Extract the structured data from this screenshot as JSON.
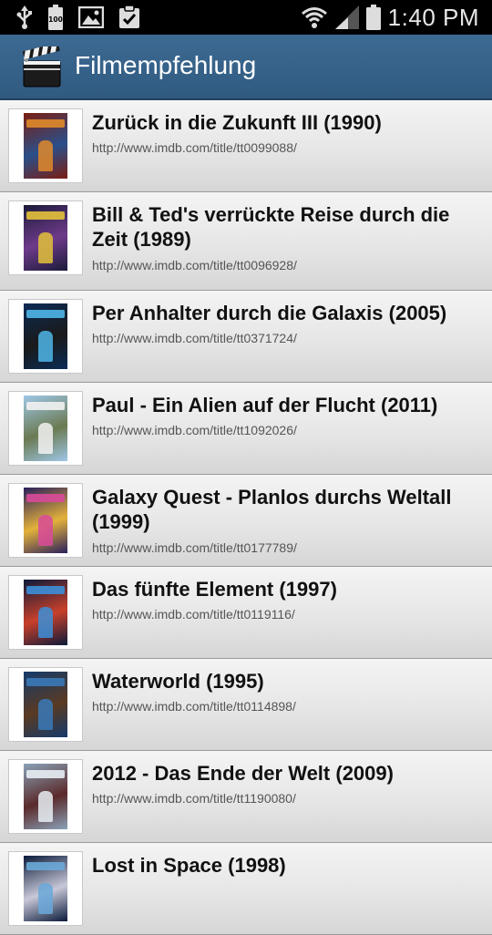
{
  "status_bar": {
    "time": "1:40 PM",
    "battery_level_text": "100",
    "left_icons": [
      "usb-icon",
      "battery-full-icon",
      "image-icon",
      "clipboard-check-icon"
    ],
    "right_icons": [
      "wifi-icon",
      "cell-signal-icon",
      "battery-icon"
    ]
  },
  "app_bar": {
    "title": "Filmempfehlung",
    "icon": "clapperboard-icon",
    "background": "#35618a"
  },
  "movies": [
    {
      "title": "Zurück in die Zukunft III (1990)",
      "url": "http://www.imdb.com/title/tt0099088/",
      "poster_colors": [
        "#7a1e12",
        "#e08a2a",
        "#2a4f8a"
      ]
    },
    {
      "title": "Bill & Ted's verrückte Reise durch die Zeit (1989)",
      "url": "http://www.imdb.com/title/tt0096928/",
      "poster_colors": [
        "#1c1b3a",
        "#e3c23a",
        "#6e3a8a"
      ]
    },
    {
      "title": "Per Anhalter durch die Galaxis (2005)",
      "url": "http://www.imdb.com/title/tt0371724/",
      "poster_colors": [
        "#0b2b55",
        "#4fb6e8",
        "#1a1a1a"
      ]
    },
    {
      "title": "Paul - Ein Alien auf der Flucht (2011)",
      "url": "http://www.imdb.com/title/tt1092026/",
      "poster_colors": [
        "#9ec7e6",
        "#f2f2f2",
        "#6b7a52"
      ]
    },
    {
      "title": "Galaxy Quest - Planlos durchs Weltall (1999)",
      "url": "http://www.imdb.com/title/tt0177789/",
      "poster_colors": [
        "#2a1f5c",
        "#d84a9a",
        "#e3b23a"
      ]
    },
    {
      "title": "Das fünfte Element (1997)",
      "url": "http://www.imdb.com/title/tt0119116/",
      "poster_colors": [
        "#0c1a3a",
        "#3c8fd8",
        "#c8402a"
      ]
    },
    {
      "title": "Waterworld (1995)",
      "url": "http://www.imdb.com/title/tt0114898/",
      "poster_colors": [
        "#143a6a",
        "#3a7ab8",
        "#5a3a22"
      ]
    },
    {
      "title": "2012 - Das Ende der Welt (2009)",
      "url": "http://www.imdb.com/title/tt1190080/",
      "poster_colors": [
        "#8aa2b8",
        "#e8eef4",
        "#5a2a2a"
      ]
    },
    {
      "title": "Lost in Space (1998)",
      "url": "",
      "poster_colors": [
        "#0a1a3a",
        "#6aa8d8",
        "#c8c8d8"
      ]
    }
  ]
}
